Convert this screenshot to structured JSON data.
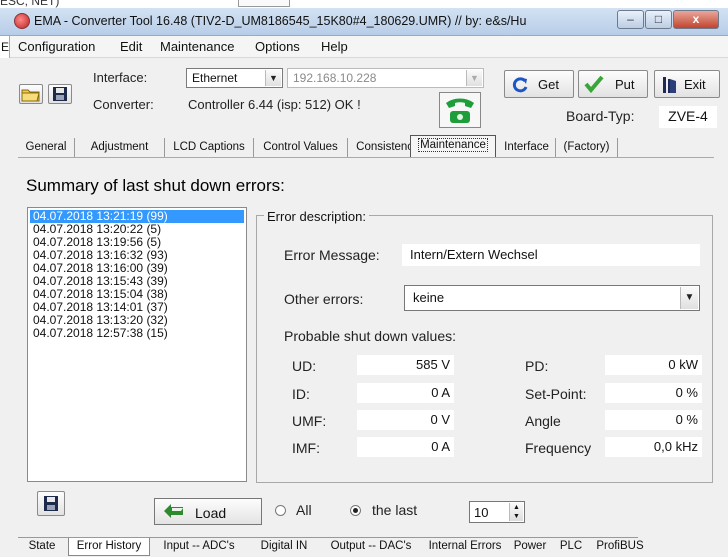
{
  "background_fragment": {
    "text": "ESC, NET)",
    "side_label": "Ei"
  },
  "window": {
    "title": "EMA - Converter Tool 16.48 (TIV2-D_UM8186545_15K80#4_180629.UMR)  // by: e&s/Hu",
    "controls": {
      "minimize": "–",
      "maximize": "□",
      "close": "x"
    }
  },
  "menu": [
    "Configuration",
    "Edit",
    "Maintenance",
    "Options",
    "Help"
  ],
  "toolbar": {
    "interface_label": "Interface:",
    "interface_value": "Ethernet",
    "ip_value": "192.168.10.228",
    "converter_label": "Converter:",
    "converter_value": "Controller 6.44 (isp: 512) OK !",
    "get_label": "Get",
    "put_label": "Put",
    "exit_label": "Exit",
    "board_label": "Board-Typ:",
    "board_value": "ZVE-4"
  },
  "tabs": {
    "items": [
      "General",
      "Adjustment",
      "LCD Captions",
      "Control Values",
      "Consistency",
      "Maintenance",
      "Interface",
      "(Factory)"
    ],
    "active": "Maintenance"
  },
  "summary_title": "Summary of last shut down errors:",
  "errors": [
    "04.07.2018 13:21:19 (99)",
    "04.07.2018 13:20:22 (5)",
    "04.07.2018 13:19:56 (5)",
    "04.07.2018 13:16:32 (93)",
    "04.07.2018 13:16:00 (39)",
    "04.07.2018 13:15:43 (39)",
    "04.07.2018 13:15:04 (38)",
    "04.07.2018 13:14:01 (37)",
    "04.07.2018 13:13:20 (32)",
    "04.07.2018 12:57:38 (15)"
  ],
  "details": {
    "group_title": "Error description:",
    "message_label": "Error Message:",
    "message_value": "Intern/Extern Wechsel",
    "other_label": "Other errors:",
    "other_value": "keine",
    "probable_label": "Probable shut down values:",
    "left_values": [
      {
        "label": "UD:",
        "value": "585 V"
      },
      {
        "label": "ID:",
        "value": "0 A"
      },
      {
        "label": "UMF:",
        "value": "0 V"
      },
      {
        "label": "IMF:",
        "value": "0 A"
      }
    ],
    "right_values": [
      {
        "label": "PD:",
        "value": "0 kW"
      },
      {
        "label": "Set-Point:",
        "value": "0 %"
      },
      {
        "label": "Angle",
        "value": "0 %"
      },
      {
        "label": "Frequency",
        "value": "0,0 kHz"
      }
    ]
  },
  "bottom": {
    "load_label": "Load",
    "radio_all": "All",
    "radio_last": "the last",
    "radio_selected": "the last",
    "count_value": "10"
  },
  "bottom_tabs": {
    "items": [
      "State",
      "Error History",
      "Input -- ADC's",
      "Digital  IN",
      "Output -- DAC's",
      "Internal Errors",
      "Power",
      "PLC",
      "ProfiBUS"
    ],
    "active": "Error History"
  },
  "colors": {
    "selection": "#3399ff",
    "phone_green": "#1e9e3a",
    "get_blue": "#1c55c8",
    "put_green": "#3aa53a"
  }
}
